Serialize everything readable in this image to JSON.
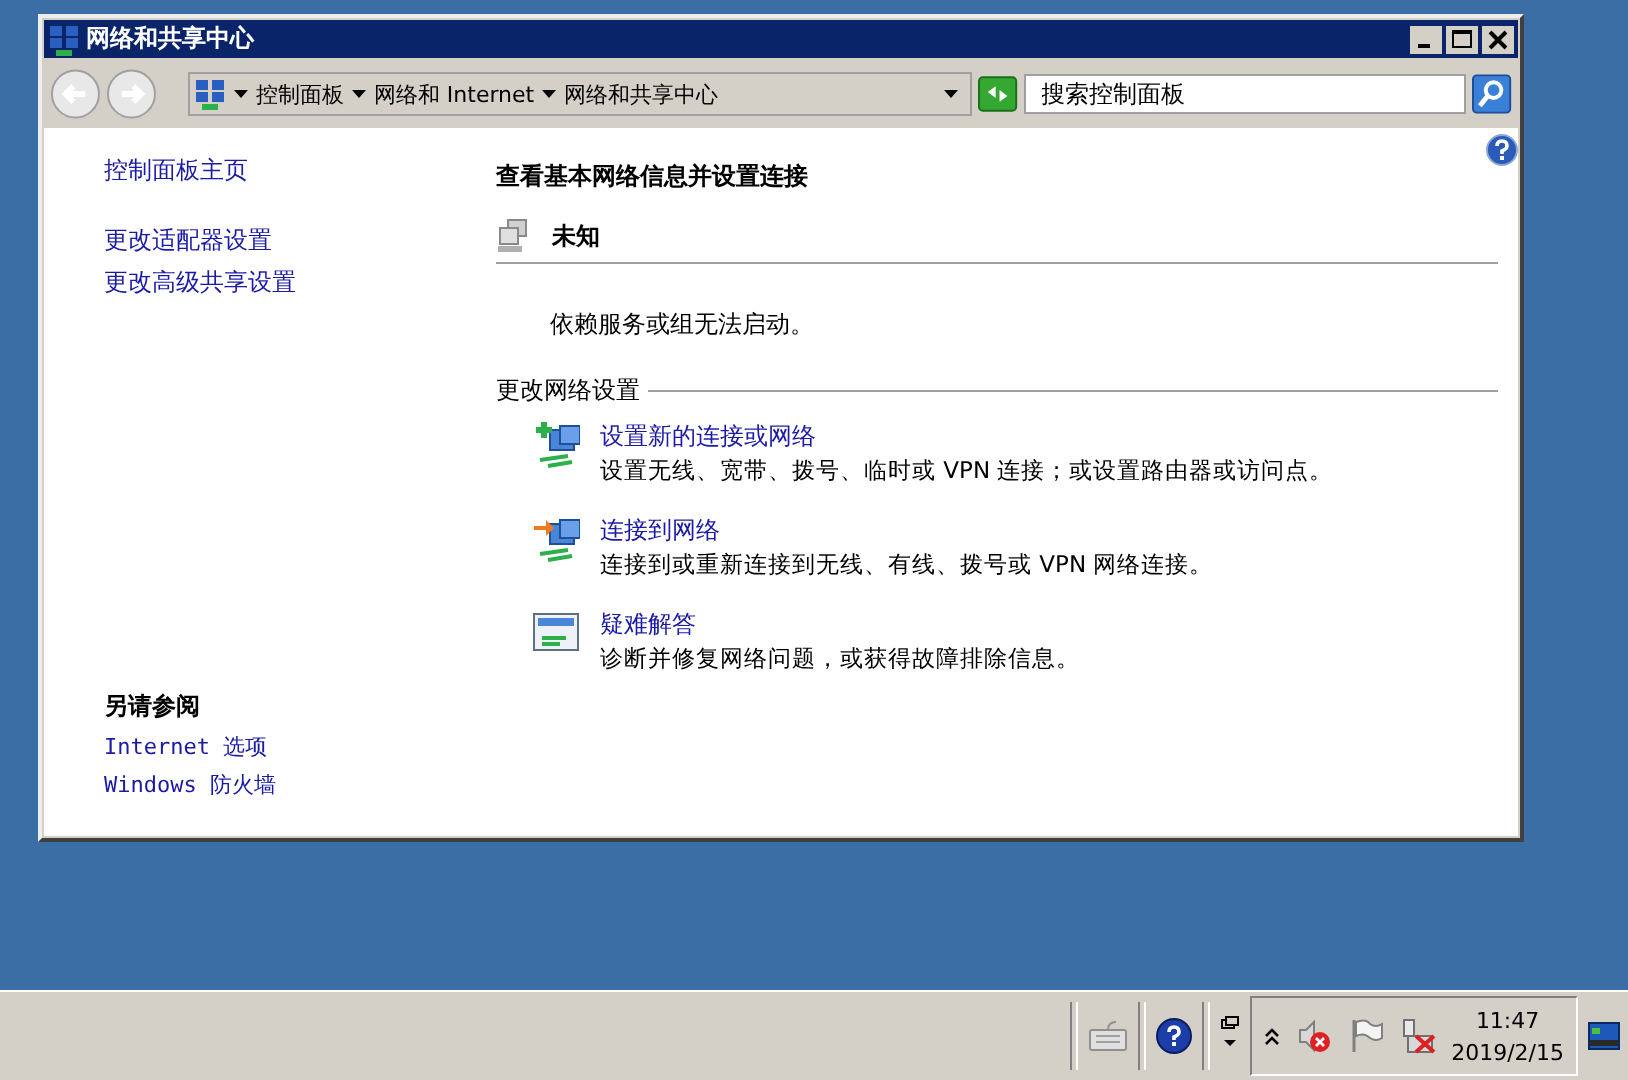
{
  "window": {
    "title": "网络和共享中心"
  },
  "address_bar": {
    "breadcrumbs": [
      "控制面板",
      "网络和 Internet",
      "网络和共享中心"
    ]
  },
  "search": {
    "placeholder": "搜索控制面板"
  },
  "sidebar": {
    "home_link": "控制面板主页",
    "tasks": [
      "更改适配器设置",
      "更改高级共享设置"
    ],
    "see_also": {
      "heading": "另请参阅",
      "links": [
        "Internet 选项",
        "Windows 防火墙"
      ]
    }
  },
  "main": {
    "heading": "查看基本网络信息并设置连接",
    "network": {
      "name": "未知"
    },
    "message": "依赖服务或组无法启动。",
    "section_title": "更改网络设置",
    "tasks": [
      {
        "kind": "new",
        "title": "设置新的连接或网络",
        "description": "设置无线、宽带、拨号、临时或 VPN 连接；或设置路由器或访问点。"
      },
      {
        "kind": "connect",
        "title": "连接到网络",
        "description": "连接到或重新连接到无线、有线、拨号或 VPN 网络连接。"
      },
      {
        "kind": "troubleshoot",
        "title": "疑难解答",
        "description": "诊断并修复网络问题，或获得故障排除信息。"
      }
    ]
  },
  "taskbar": {
    "clock": {
      "time": "11:47",
      "date": "2019/2/15"
    }
  }
}
